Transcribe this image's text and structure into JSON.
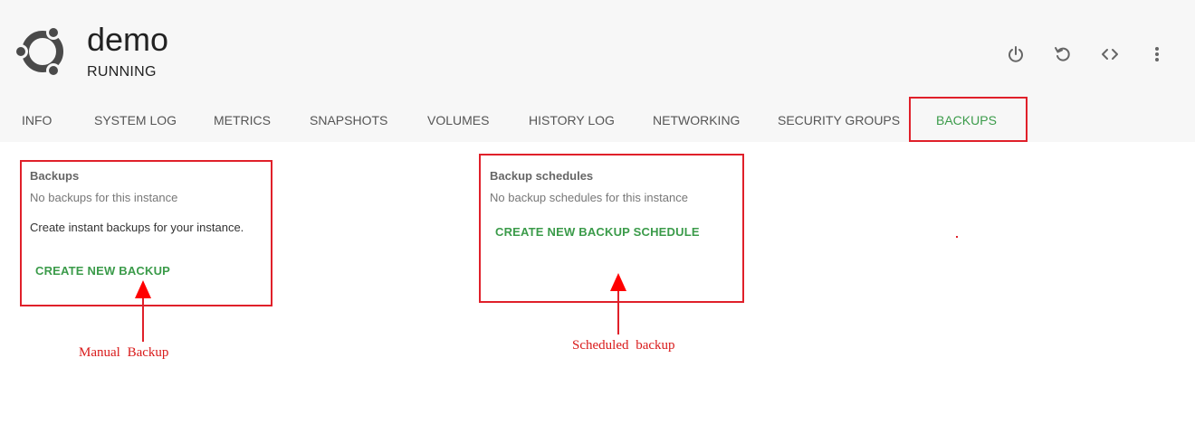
{
  "instance": {
    "name": "demo",
    "status": "RUNNING"
  },
  "actions": [
    {
      "icon": "power-icon"
    },
    {
      "icon": "restart-icon"
    },
    {
      "icon": "code-icon"
    },
    {
      "icon": "more-vertical-icon"
    }
  ],
  "tabs": [
    {
      "label": "INFO"
    },
    {
      "label": "SYSTEM LOG"
    },
    {
      "label": "METRICS"
    },
    {
      "label": "SNAPSHOTS"
    },
    {
      "label": "VOLUMES"
    },
    {
      "label": "HISTORY LOG"
    },
    {
      "label": "NETWORKING"
    },
    {
      "label": "SECURITY GROUPS"
    },
    {
      "label": "BACKUPS",
      "active": true
    }
  ],
  "backups": {
    "title": "Backups",
    "empty_text": "No backups for this instance",
    "description": "Create instant backups for your instance.",
    "button_label": "CREATE NEW BACKUP"
  },
  "schedules": {
    "title": "Backup schedules",
    "empty_text": "No backup schedules for this instance",
    "button_label": "CREATE NEW BACKUP SCHEDULE"
  },
  "annotations": {
    "manual": "Manual Backup",
    "scheduled": "Scheduled backup"
  },
  "colors": {
    "accent_green": "#3b9b4a",
    "annotation_red": "#e0202a",
    "header_bg": "#f7f7f7"
  }
}
